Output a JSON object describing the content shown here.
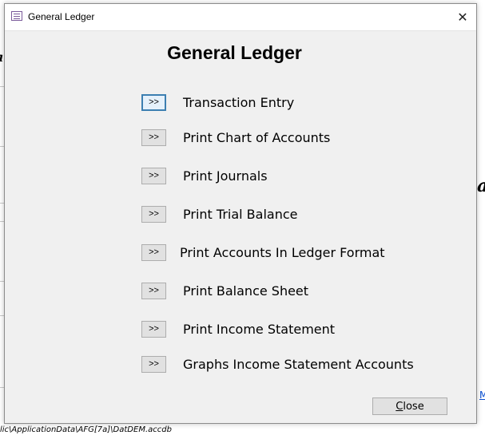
{
  "window": {
    "title": "General Ledger",
    "close_glyph": "✕",
    "icon": "form-icon"
  },
  "heading": "General Ledger",
  "menu": [
    {
      "button": ">>",
      "label": "Transaction Entry"
    },
    {
      "button": ">>",
      "label": "Print Chart of Accounts"
    },
    {
      "button": ">>",
      "label": "Print Journals"
    },
    {
      "button": ">>",
      "label": "Print Trial Balance"
    },
    {
      "button": ">>",
      "label": "Print Accounts In Ledger Format"
    },
    {
      "button": ">>",
      "label": "Print Balance Sheet"
    },
    {
      "button": ">>",
      "label": "Print Income Statement"
    },
    {
      "button": ">>",
      "label": "Graphs Income Statement Accounts"
    }
  ],
  "close_button": {
    "access_key": "C",
    "rest": "lose"
  },
  "background": {
    "fragment_left": "a",
    "fragment_right": "a",
    "link_fragment": "M",
    "status_path": "lic\\ApplicationData\\AFG[7a]\\DatDEM.accdb"
  },
  "colors": {
    "dialog_bg": "#f0f0f0",
    "button_bg": "#e1e1e1",
    "focus_border": "#3c7fb1",
    "link": "#0a4fd1"
  }
}
